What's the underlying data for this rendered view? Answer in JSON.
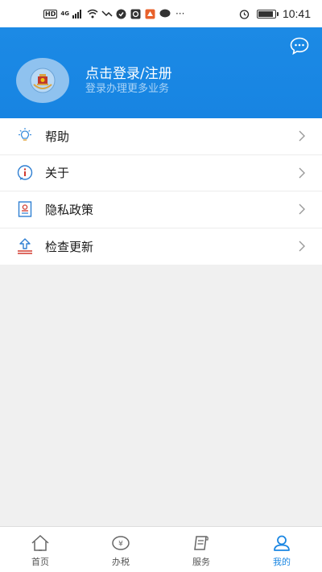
{
  "status_bar": {
    "network_badge": "HD",
    "generation": "4G",
    "time": "10:41",
    "battery_level": 0.9
  },
  "header": {
    "login_title": "点击登录/注册",
    "login_subtitle": "登录办理更多业务",
    "bg_color": "#1784e2"
  },
  "menu": {
    "items": [
      {
        "label": "帮助",
        "icon": "lightbulb-icon"
      },
      {
        "label": "关于",
        "icon": "info-icon"
      },
      {
        "label": "隐私政策",
        "icon": "document-icon"
      },
      {
        "label": "检查更新",
        "icon": "update-icon"
      }
    ]
  },
  "tabs": [
    {
      "label": "首页",
      "icon": "home-icon",
      "active": false
    },
    {
      "label": "办税",
      "icon": "tax-icon",
      "active": false
    },
    {
      "label": "服务",
      "icon": "service-icon",
      "active": false
    },
    {
      "label": "我的",
      "icon": "profile-icon",
      "active": true
    }
  ],
  "colors": {
    "accent": "#1a86e2",
    "background": "#f0f0f0"
  }
}
